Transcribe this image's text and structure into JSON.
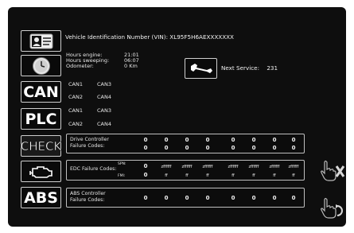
{
  "vin": {
    "label": "Vehicle Identification Number (VIN): XL95F5H6AEXXXXXXX"
  },
  "info": {
    "hours_engine_label": "Hours engine:",
    "hours_sweeping_label": "Hours sweeping:",
    "odometer_label": "Odometer:",
    "hours_engine": "21:01",
    "hours_sweeping": "06:07",
    "odometer": "0 Km"
  },
  "service": {
    "label": "Next Service:",
    "value": "231"
  },
  "left_buttons": {
    "can": "CAN",
    "plc": "PLC",
    "check": "CHECK",
    "abs": "ABS"
  },
  "can_status": [
    {
      "a": "CAN1",
      "b": "CAN3"
    },
    {
      "a": "CAN2",
      "b": "CAN4"
    },
    {
      "a": "CAN1",
      "b": "CAN3"
    },
    {
      "a": "CAN2",
      "b": "CAN4"
    }
  ],
  "drive_controller": {
    "label1": "Drive Controller",
    "label2": "Failure Codes:",
    "row1": [
      "0",
      "0",
      "0",
      "0",
      "0",
      "0",
      "0",
      "0"
    ],
    "row2": [
      "0",
      "0",
      "0",
      "0",
      "0",
      "0",
      "0",
      "0"
    ]
  },
  "edc": {
    "label": "EDC Failure Codes:",
    "spn_label": "SPN:",
    "fmi_label": "FMI:",
    "spn": [
      "0",
      "zffffff",
      "zffffff",
      "zffffff",
      "zffffff",
      "zffffff",
      "zffffff",
      "zffffff"
    ],
    "fmi": [
      "0",
      "ff",
      "ff",
      "ff",
      "ff",
      "ff",
      "ff",
      "ff"
    ]
  },
  "abs_controller": {
    "label1": "ABS Controller",
    "label2": "Failure Codes:",
    "values": [
      "0",
      "0",
      "0",
      "0",
      "0",
      "0",
      "0",
      "0"
    ]
  },
  "icons": {
    "id_card": "id-card-icon",
    "clock": "clock-icon",
    "engine": "engine-icon",
    "wrench": "wrench-icon",
    "cancel": "hand-x-icon",
    "refresh": "hand-refresh-icon"
  },
  "colors": {
    "background": "#0e0e0e",
    "text": "#f0f0f0",
    "border": "#cfcfcf"
  }
}
